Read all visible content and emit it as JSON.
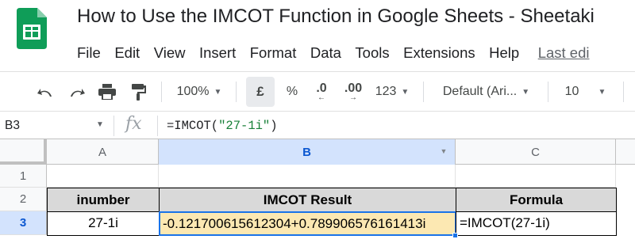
{
  "app": {
    "title": "How to Use the IMCOT Function in Google Sheets - Sheetaki",
    "logo_icon": "google-sheets-icon",
    "brand_color": "#0f9d58"
  },
  "menu": {
    "items": [
      "File",
      "Edit",
      "View",
      "Insert",
      "Format",
      "Data",
      "Tools",
      "Extensions",
      "Help"
    ],
    "last_edit": "Last edi"
  },
  "toolbar": {
    "undo_icon": "undo-icon",
    "redo_icon": "redo-icon",
    "print_icon": "print-icon",
    "paint_format_icon": "paint-format-icon",
    "zoom": "100%",
    "currency": "£",
    "percent": "%",
    "decrease_decimal": ".0",
    "increase_decimal": ".00",
    "more_formats": "123",
    "font": "Default (Ari...",
    "font_size": "10"
  },
  "formula_bar": {
    "name_box": "B3",
    "fx": "fx",
    "formula_prefix": "=IMCOT(",
    "formula_string": "\"27-1i\"",
    "formula_suffix": ")"
  },
  "grid": {
    "columns": [
      "A",
      "B",
      "C"
    ],
    "selected_column": "B",
    "rows": [
      "1",
      "2",
      "3"
    ],
    "selected_row": "3",
    "header_row": {
      "a": "inumber",
      "b": "IMCOT Result",
      "c": "Formula"
    },
    "data_row": {
      "a": "27-1i",
      "b": "-0.121700615612304+0.789906576161413i",
      "c": "=IMCOT(27-1i)"
    },
    "colors": {
      "header_fill": "#d9d9d9",
      "result_fill": "#fce8b2",
      "selection": "#1a73e8"
    }
  }
}
